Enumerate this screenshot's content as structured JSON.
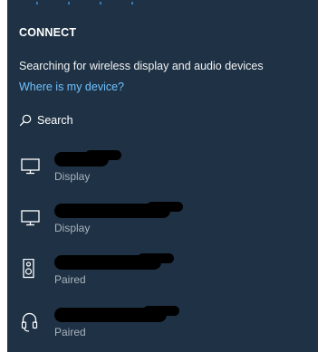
{
  "panel": {
    "title": "CONNECT",
    "status_text": "Searching for wireless display and audio devices",
    "help_link": "Where is my device?"
  },
  "search": {
    "label": "Search",
    "icon": "search-icon"
  },
  "devices": [
    {
      "name": "",
      "subtitle": "Display",
      "icon": "monitor-icon"
    },
    {
      "name": "",
      "subtitle": "Display",
      "icon": "monitor-icon"
    },
    {
      "name": "",
      "subtitle": "Paired",
      "icon": "speaker-icon"
    },
    {
      "name": "",
      "subtitle": "Paired",
      "icon": "headset-icon"
    }
  ],
  "colors": {
    "panel_background": "#1f3245",
    "link": "#6fc2ff",
    "secondary_text": "#a9b3bd"
  }
}
